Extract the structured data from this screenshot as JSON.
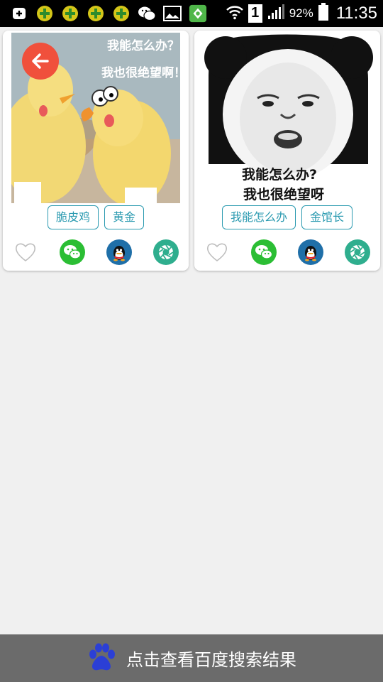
{
  "status_bar": {
    "battery": "92%",
    "time": "11:35",
    "sim_slot": "1",
    "notification_icons": [
      "usb-add-icon",
      "security-app-icon",
      "security-app-icon",
      "security-app-icon",
      "security-app-icon",
      "wechat-icon",
      "image-icon",
      "app-store-icon"
    ]
  },
  "cards": [
    {
      "image_caption_line1": "我能怎么办？",
      "image_caption_line2": "我也很绝望啊！",
      "tags": [
        "脆皮鸡",
        "黄金"
      ]
    },
    {
      "image_caption_line1": "我能怎么办?",
      "image_caption_line2": "我也很绝望呀",
      "tags": [
        "我能怎么办",
        "金馆长"
      ]
    }
  ],
  "bottom_bar": {
    "label": "点击查看百度搜索结果"
  },
  "colors": {
    "tag_border": "#2a9ab0",
    "back_button": "#f0503c",
    "wechat_green": "#2bbe34",
    "moments_teal": "#2fae8e",
    "bottom_bar": "#6b6b6b"
  }
}
